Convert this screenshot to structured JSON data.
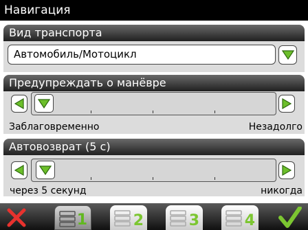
{
  "window": {
    "title": "Навигация"
  },
  "transport": {
    "header": "Вид транспорта",
    "selected": "Автомобиль/Мотоцикл",
    "dropdown_icon": "chevron-down-icon"
  },
  "warn": {
    "header": "Предупреждать о манёвре",
    "left_label": "Заблаговременно",
    "right_label": "Незадолго",
    "position": 0
  },
  "autoreturn": {
    "header": "Автовозврат (5 с)",
    "left_label": "через 5 секунд",
    "right_label": "никогда",
    "position": 0
  },
  "toolbar": {
    "cancel_icon": "close-icon",
    "ok_icon": "checkmark-icon",
    "tabs": [
      {
        "label": "1",
        "active": true
      },
      {
        "label": "2",
        "active": false
      },
      {
        "label": "3",
        "active": false
      },
      {
        "label": "4",
        "active": false
      }
    ]
  },
  "colors": {
    "accent_green": "#6cbf2a",
    "cancel_red": "#e8322e",
    "header_dark": "#202020",
    "panel_gray": "#dcdcdc"
  }
}
